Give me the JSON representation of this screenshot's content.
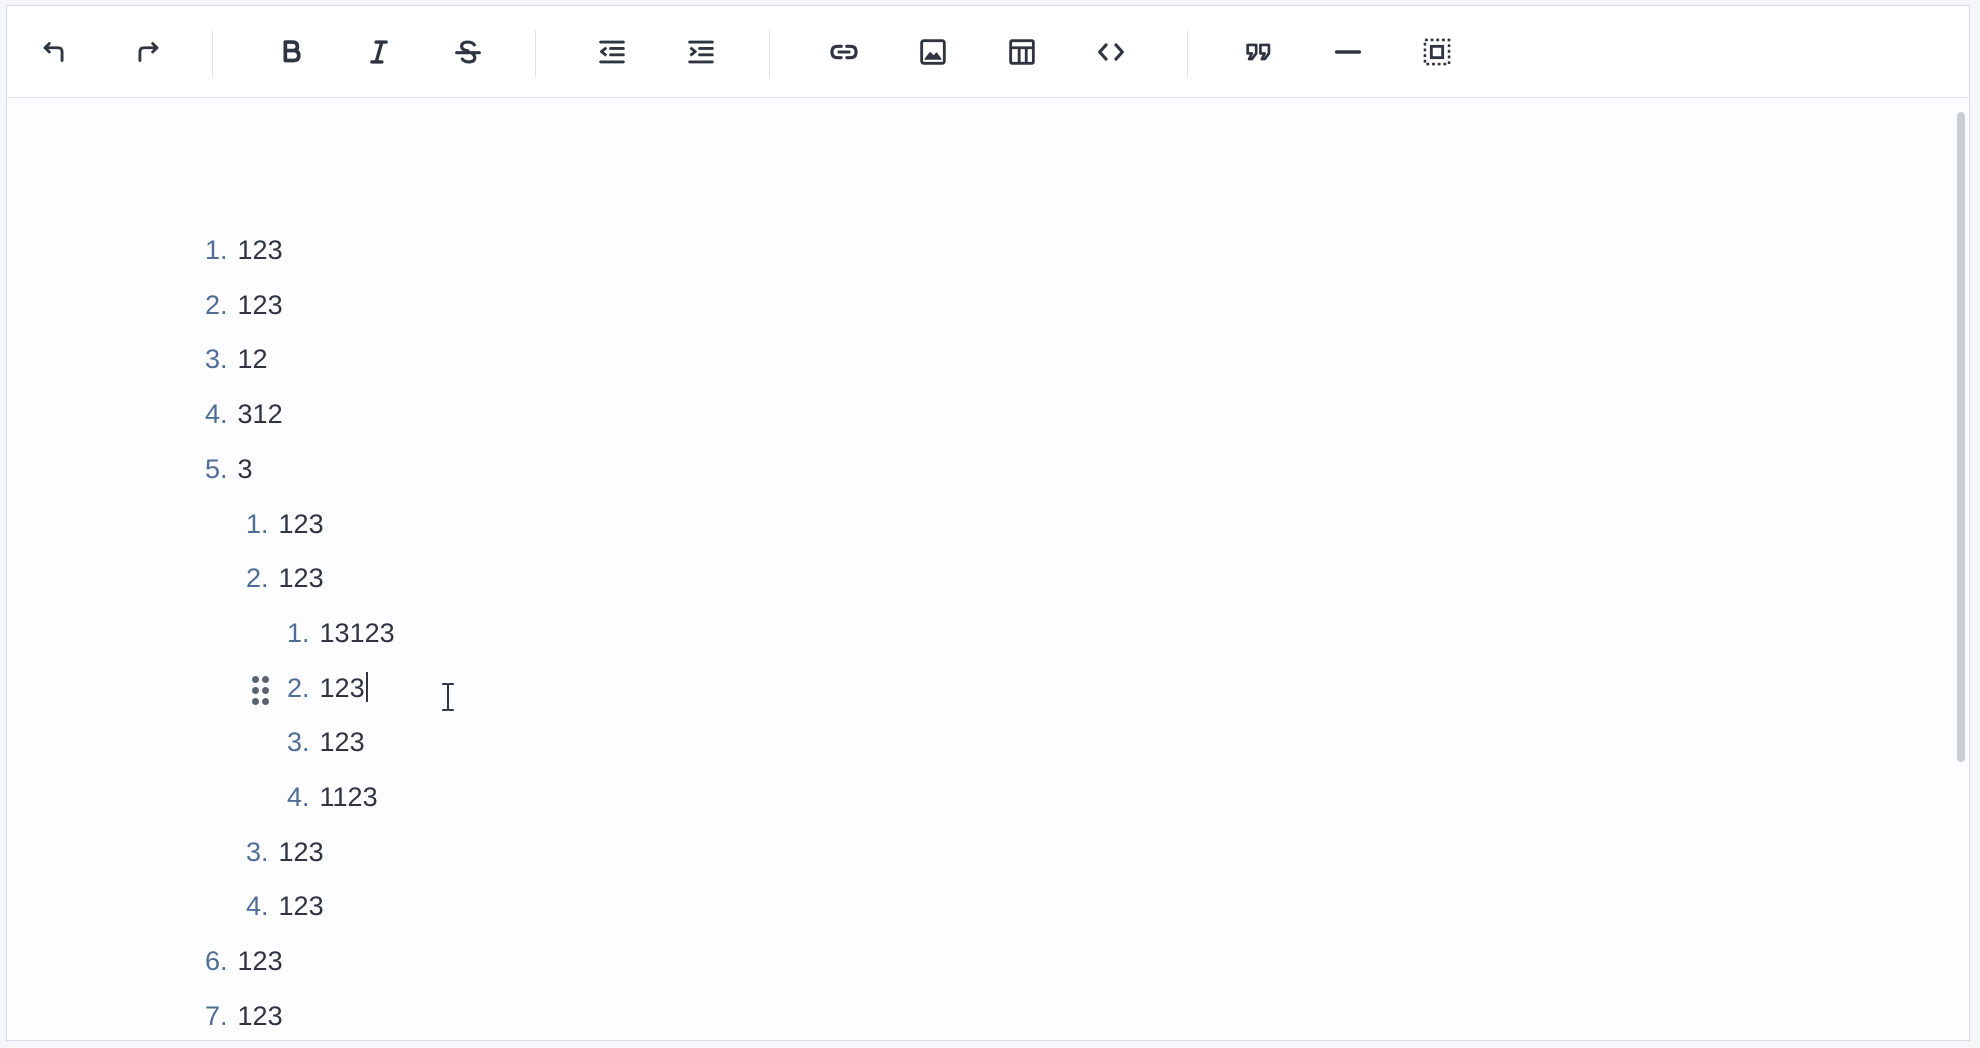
{
  "toolbar": {
    "groups": [
      [
        "undo-icon",
        "redo-icon"
      ],
      [
        "bold-icon",
        "italic-icon",
        "strikethrough-icon"
      ],
      [
        "outdent-icon",
        "indent-icon"
      ],
      [
        "link-icon",
        "image-icon",
        "table-icon",
        "code-icon"
      ],
      [
        "quote-icon",
        "horizontal-rule-icon",
        "select-all-icon"
      ]
    ]
  },
  "editor": {
    "items": [
      {
        "marker": "1.",
        "text": "123",
        "level": 1
      },
      {
        "marker": "2.",
        "text": "123",
        "level": 1
      },
      {
        "marker": "3.",
        "text": "12",
        "level": 1
      },
      {
        "marker": "4.",
        "text": "312",
        "level": 1
      },
      {
        "marker": "5.",
        "text": "3",
        "level": 1
      },
      {
        "marker": "1.",
        "text": "123",
        "level": 2
      },
      {
        "marker": "2.",
        "text": "123",
        "level": 2
      },
      {
        "marker": "1.",
        "text": "13123",
        "level": 3
      },
      {
        "marker": "2.",
        "text": "123",
        "level": 3,
        "cursor": true
      },
      {
        "marker": "3.",
        "text": "123",
        "level": 3
      },
      {
        "marker": "4.",
        "text": "1123",
        "level": 3
      },
      {
        "marker": "3.",
        "text": "123",
        "level": 2
      },
      {
        "marker": "4.",
        "text": "123",
        "level": 2
      },
      {
        "marker": "6.",
        "text": "123",
        "level": 1
      },
      {
        "marker": "7.",
        "text": "123",
        "level": 1
      }
    ]
  },
  "colors": {
    "marker": "#4f6d97",
    "text": "#2f3440",
    "icon": "#2f3440",
    "background": "#fdfdff"
  }
}
